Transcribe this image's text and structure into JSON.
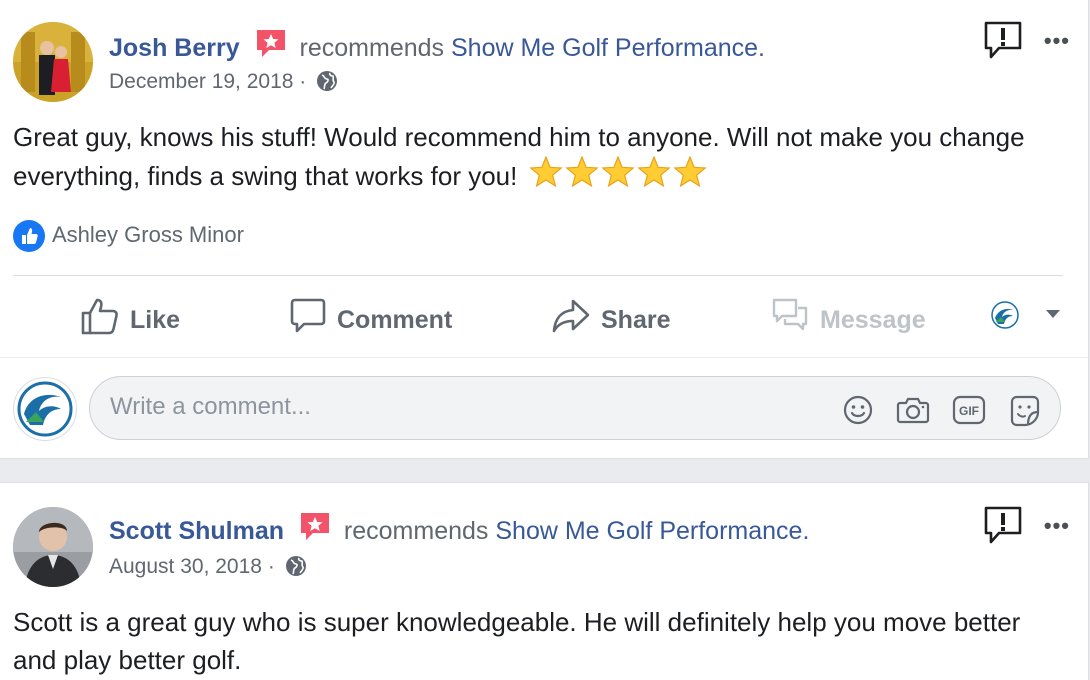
{
  "reviews": [
    {
      "author": "Josh Berry",
      "verb": "recommends",
      "page": "Show Me Golf Performance.",
      "date": "December 19, 2018",
      "date_separator": "·",
      "text": "Great guy, knows his stuff! Would recommend him to anyone. Will not make you change everything, finds a swing that works for you!",
      "stars": 5,
      "liked_by": "Ashley Gross Minor",
      "actions": {
        "like": "Like",
        "comment": "Comment",
        "share": "Share",
        "message": "Message"
      },
      "comment_placeholder": "Write a comment..."
    },
    {
      "author": "Scott Shulman",
      "verb": "recommends",
      "page": "Show Me Golf Performance.",
      "date": "August 30, 2018",
      "date_separator": "·",
      "text": "Scott is a great guy who is super knowledgeable. He will definitely help you move better and play better golf."
    }
  ],
  "more_label": "•••",
  "colors": {
    "link": "#385898",
    "meta": "#606770",
    "badge": "#f35369",
    "like_blue": "#1877f2"
  },
  "icons": [
    "recommendation-badge-icon",
    "globe-icon",
    "report-icon",
    "more-icon",
    "like-thumb-icon",
    "comment-bubble-icon",
    "share-arrow-icon",
    "message-icon",
    "page-logo-icon",
    "dropdown-caret-icon",
    "emoji-icon",
    "camera-icon",
    "gif-icon",
    "sticker-icon"
  ]
}
